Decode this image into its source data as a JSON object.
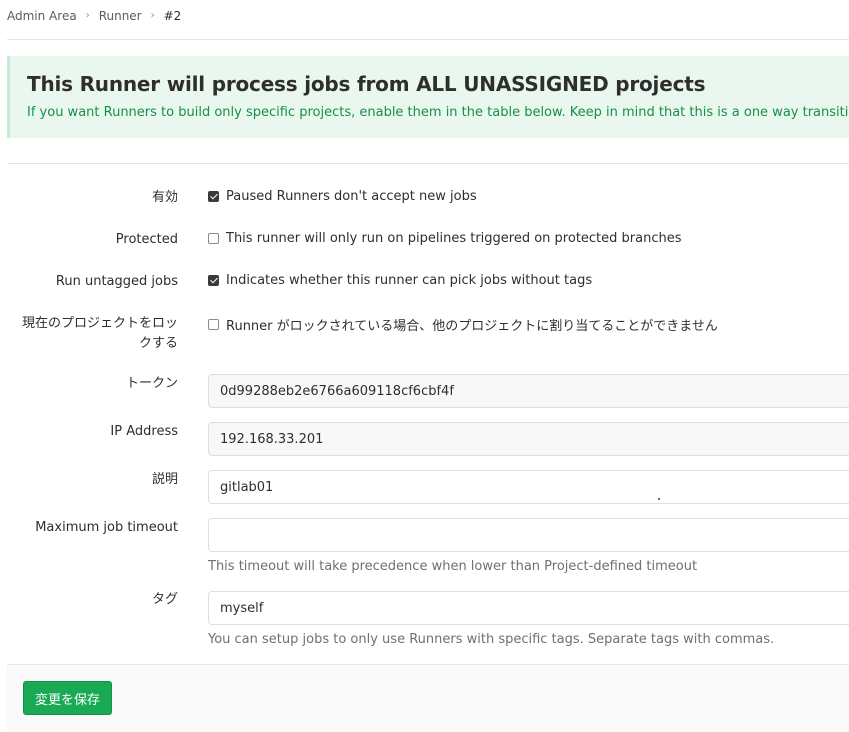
{
  "breadcrumb": {
    "items": [
      "Admin Area",
      "Runner"
    ],
    "current": "#2",
    "separator_icon": "chevron-right-icon"
  },
  "banner": {
    "title": "This Runner will process jobs from ALL UNASSIGNED projects",
    "text": "If you want Runners to build only specific projects, enable them in the table below. Keep in mind that this is a one way transition."
  },
  "form": {
    "active": {
      "label": "有効",
      "checked": true,
      "text": "Paused Runners don't accept new jobs"
    },
    "protected": {
      "label": "Protected",
      "checked": false,
      "text": "This runner will only run on pipelines triggered on protected branches"
    },
    "run_untagged": {
      "label": "Run untagged jobs",
      "checked": true,
      "text": "Indicates whether this runner can pick jobs without tags"
    },
    "locked": {
      "label_line1": "現在のプロジェクトをロッ",
      "label_line2": "クする",
      "checked": false,
      "text": "Runner がロックされている場合、他のプロジェクトに割り当てることができません"
    },
    "token": {
      "label": "トークン",
      "value": "0d99288eb2e6766a609118cf6cbf4f"
    },
    "ip_address": {
      "label": "IP Address",
      "value": "192.168.33.201"
    },
    "description": {
      "label": "説明",
      "value": "gitlab01"
    },
    "max_timeout": {
      "label": "Maximum job timeout",
      "value": "",
      "help": "This timeout will take precedence when lower than Project-defined timeout"
    },
    "tags": {
      "label": "タグ",
      "value": "myself",
      "help": "You can setup jobs to only use Runners with specific tags. Separate tags with commas."
    }
  },
  "actions": {
    "save_label": "変更を保存"
  },
  "colors": {
    "banner_bg": "#e9f7ef",
    "banner_text": "#168f48",
    "save_button": "#1aaa55"
  }
}
